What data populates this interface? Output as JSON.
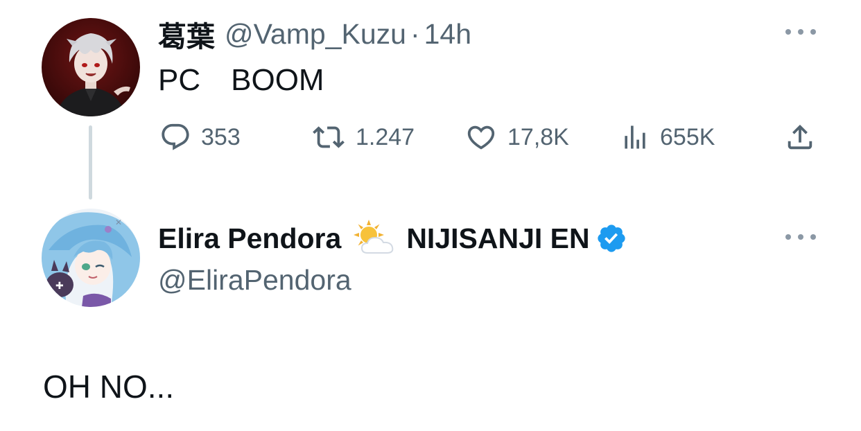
{
  "tweet1": {
    "display_name": "葛葉",
    "handle": "@Vamp_Kuzu",
    "separator": "·",
    "time": "14h",
    "text": "PC　BOOM",
    "actions": {
      "reply_count": "353",
      "retweet_count": "1.247",
      "like_count": "17,8K",
      "view_count": "655K"
    }
  },
  "tweet2": {
    "display_name_part1": "Elira Pendora",
    "display_name_part2": "NIJISANJI EN",
    "name_emoji": "sun-behind-cloud-icon",
    "verified": true,
    "handle": "@EliraPendora",
    "text": "OH NO..."
  },
  "colors": {
    "text_primary": "#0f1419",
    "text_secondary": "#536471",
    "verified_blue": "#1d9bf0",
    "thread_line": "#cfd9de"
  }
}
